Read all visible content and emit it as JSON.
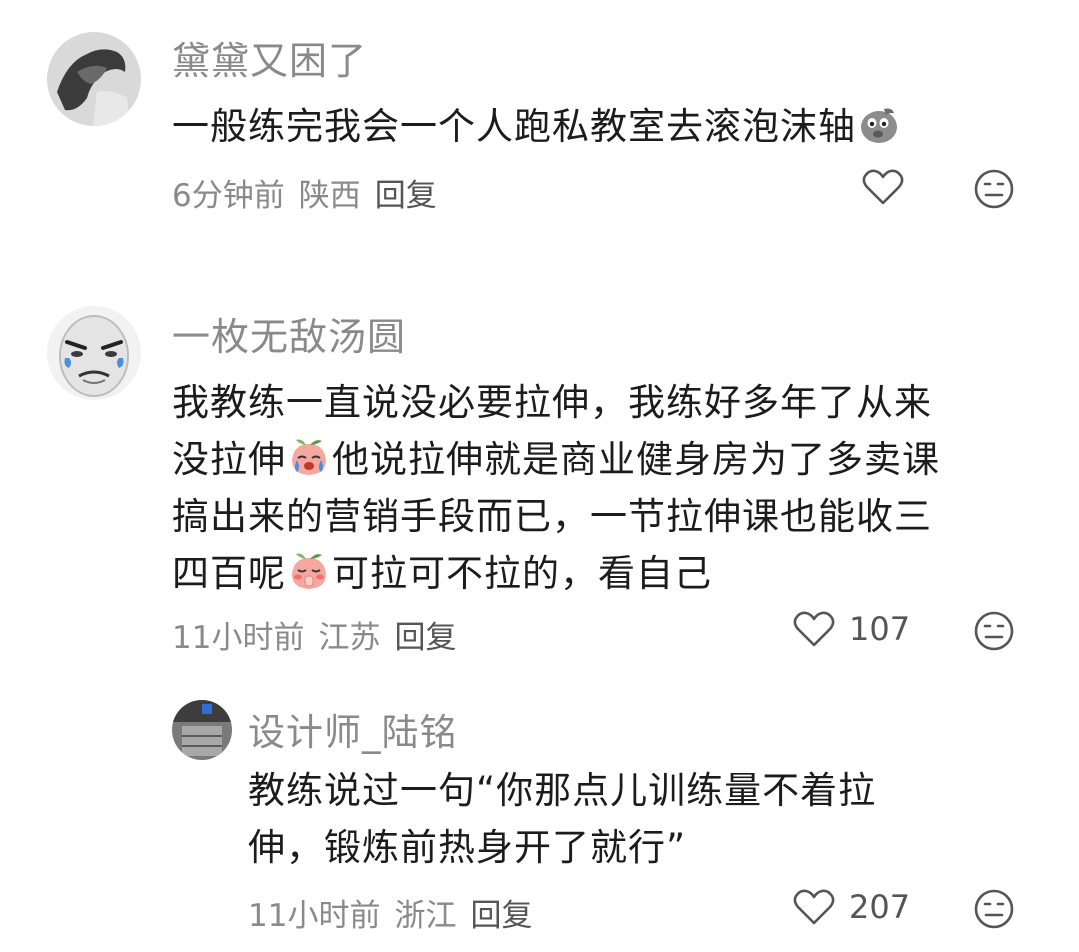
{
  "comments": [
    {
      "username": "黛黛又困了",
      "text_parts": [
        "一般练完我会一个人跑私教室去滚泡沫轴"
      ],
      "emojis": [
        "emoji-pig-sad"
      ],
      "time": "6分钟前",
      "location": "陕西",
      "reply_label": "回复",
      "likes": ""
    },
    {
      "username": "一枚无敌汤圆",
      "line1": "我教练一直说没必要拉伸，我练好多年了从来",
      "line2a": "没拉伸",
      "line2b": "他说拉伸就是商业健身房为了多卖课",
      "line3": "搞出来的营销手段而已，一节拉伸课也能收三",
      "line4a": "四百呢",
      "line4b": "可拉可不拉的，看自己",
      "emojis": [
        "emoji-peach-crying",
        "emoji-peach-shy"
      ],
      "time": "11小时前",
      "location": "江苏",
      "reply_label": "回复",
      "likes": "107"
    },
    {
      "username": "设计师_陆铭",
      "line1": "教练说过一句“你那点儿训练量不着拉",
      "line2": "伸，锻炼前热身开了就行”",
      "time": "11小时前",
      "location": "浙江",
      "reply_label": "回复",
      "likes": "207"
    }
  ],
  "icons": {
    "like": "heart-outline-icon",
    "dislike": "meh-face-icon"
  },
  "colors": {
    "secondary_text": "#8a8a8a",
    "primary_text": "#1c1c1c",
    "icon_stroke": "#555555"
  }
}
